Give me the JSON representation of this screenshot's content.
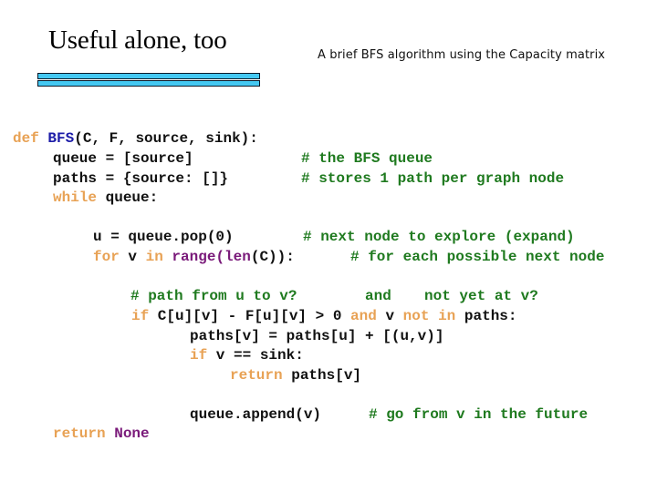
{
  "slide": {
    "title": "Useful alone, too",
    "subtitle": "A brief BFS algorithm using the Capacity matrix"
  },
  "colors": {
    "keyword": "#e8a255",
    "function_name": "#1c1ca8",
    "builtin": "#7a1a7a",
    "comment": "#1f7a1f",
    "text": "#111111",
    "title_bar": "#44c8f2"
  },
  "code": {
    "line1": {
      "kw": "def",
      "fn": "BFS",
      "rest": "(C, F, source, sink):"
    },
    "line2": {
      "code": "queue = [source]",
      "comment": "# the BFS queue"
    },
    "line3": {
      "code": "paths = {source: []}",
      "comment": "# stores 1 path per graph node"
    },
    "line4": {
      "kw": "while",
      "rest": " queue:"
    },
    "line5": {
      "code": "u = queue.pop(0)",
      "comment": "# next node to explore (expand)"
    },
    "line6": {
      "kw1": "for",
      "v": " v ",
      "kw2": "in",
      "bi": " range(len",
      "rest": "(C)):",
      "comment": "# for each possible next node"
    },
    "line7": {
      "comment1": "# path from u to v?",
      "comment2": "and",
      "comment3": "not yet at v?"
    },
    "line8": {
      "kw1": "if",
      "expr": " C[u][v] - F[u][v] > 0 ",
      "kw2": "and",
      "v": " v ",
      "kw3": "not in",
      "rest": " paths:"
    },
    "line9": {
      "code": "paths[v] = paths[u] + [(u,v)]"
    },
    "line10": {
      "kw": "if",
      "rest": " v == sink:"
    },
    "line11": {
      "kw": "return",
      "rest": " paths[v]"
    },
    "line12": {
      "code": "queue.append(v)",
      "comment": "# go from v in the future"
    },
    "line13": {
      "kw": "return",
      "bi": " None"
    }
  }
}
